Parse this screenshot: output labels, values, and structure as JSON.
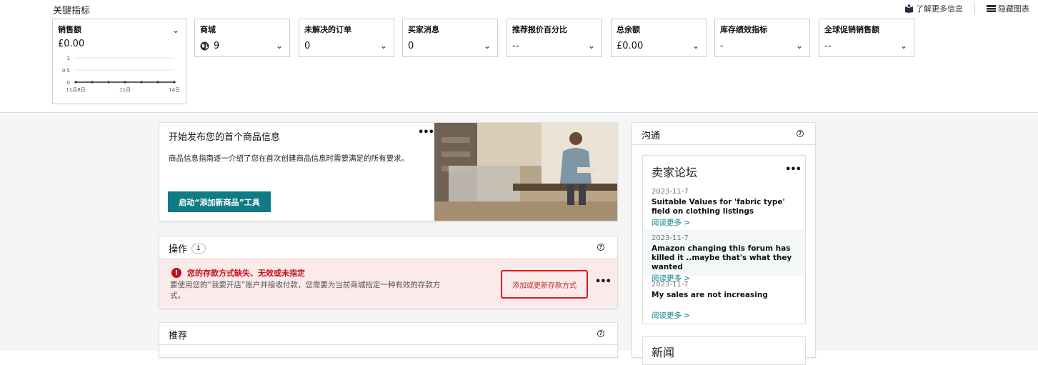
{
  "header": {
    "title": "关键指标",
    "learn_more": "了解更多信息",
    "hide_charts": "隐藏图表"
  },
  "metrics": [
    {
      "label": "销售额",
      "value": "£0.00"
    },
    {
      "label": "商城",
      "value": "9"
    },
    {
      "label": "未解决的订单",
      "value": "0"
    },
    {
      "label": "买家消息",
      "value": "0"
    },
    {
      "label": "推荐报价百分比",
      "value": "--"
    },
    {
      "label": "总余额",
      "value": "£0.00"
    },
    {
      "label": "库存绩效指标",
      "value": "-"
    },
    {
      "label": "全球促销销售额",
      "value": "--"
    }
  ],
  "chart_data": {
    "type": "line",
    "x": [
      "11月8日",
      "",
      "",
      "11日",
      "",
      "",
      "14日"
    ],
    "y_ticks": [
      "1",
      "0.5",
      "0"
    ],
    "ylim": [
      0,
      1
    ],
    "values": [
      0,
      0,
      0,
      0,
      0,
      0,
      0
    ],
    "x_tick_labels": [
      "11月8日",
      "11日",
      "14日"
    ]
  },
  "listing": {
    "title": "开始发布您的首个商品信息",
    "desc": "商品信息指南逐一介绍了您在首次创建商品信息时需要满足的所有要求。",
    "button": "启动“添加新商品”工具"
  },
  "actions": {
    "title": "操作",
    "count": "1",
    "alert_title": "您的存款方式缺失、无效或未指定",
    "alert_body": "要使用您的“我要开店”账户并接收付款，您需要为当前商城指定一种有效的存款方式。",
    "alert_button": "添加或更新存款方式"
  },
  "recommend": {
    "title": "推荐"
  },
  "comm": {
    "title": "沟通",
    "forum_title": "卖家论坛",
    "posts": [
      {
        "date": "2023-11-7",
        "title": "Suitable Values for 'fabric type' field on clothing listings",
        "more": "阅读更多 >"
      },
      {
        "date": "2023-11-7",
        "title": "Amazon changing this forum has killed it ..maybe that's what they wanted",
        "more": "阅读更多 >"
      },
      {
        "date": "2023-11-7",
        "title": "My sales are not increasing",
        "more": "阅读更多 >"
      }
    ],
    "news_title": "新闻"
  },
  "colors": {
    "teal": "#0f7b86",
    "alert_red": "#c40f1a",
    "link": "#0a7e91"
  }
}
